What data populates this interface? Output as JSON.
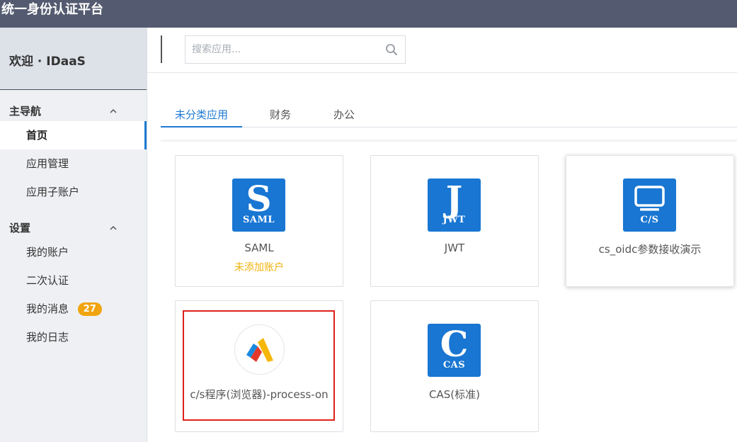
{
  "app": {
    "title": "统一身份认证平台"
  },
  "sidebar": {
    "welcome": "欢迎 · IDaaS",
    "groups": [
      {
        "title": "主导航",
        "items": [
          {
            "label": "首页",
            "active": true
          },
          {
            "label": "应用管理"
          },
          {
            "label": "应用子账户"
          }
        ]
      },
      {
        "title": "设置",
        "items": [
          {
            "label": "我的账户"
          },
          {
            "label": "二次认证"
          },
          {
            "label": "我的消息",
            "badge": "27"
          },
          {
            "label": "我的日志"
          }
        ]
      }
    ]
  },
  "search": {
    "placeholder": "搜索应用...",
    "value": ""
  },
  "tabs": [
    {
      "label": "未分类应用",
      "active": true
    },
    {
      "label": "财务"
    },
    {
      "label": "办公"
    }
  ],
  "apps": [
    {
      "name": "SAML",
      "icon_letter": "S",
      "icon_caption": "SAML",
      "status": "未添加账户"
    },
    {
      "name": "JWT",
      "icon_letter": "J",
      "icon_caption": "JWT"
    },
    {
      "name": "cs_oidc参数接收演示",
      "icon_name": "monitor-icon",
      "icon_caption": "C/S"
    },
    {
      "name": "c/s程序(浏览器)-process-on",
      "icon_name": "process-on-logo-icon"
    },
    {
      "name": "CAS(标准)",
      "icon_letter": "C",
      "icon_caption": "CAS"
    }
  ],
  "colors": {
    "topbar": "#545b70",
    "accent": "#1e7bd3",
    "app_icon": "#1976d2",
    "badge": "#f0a40f",
    "status": "#f0b30f",
    "highlight": "#e0201a"
  }
}
